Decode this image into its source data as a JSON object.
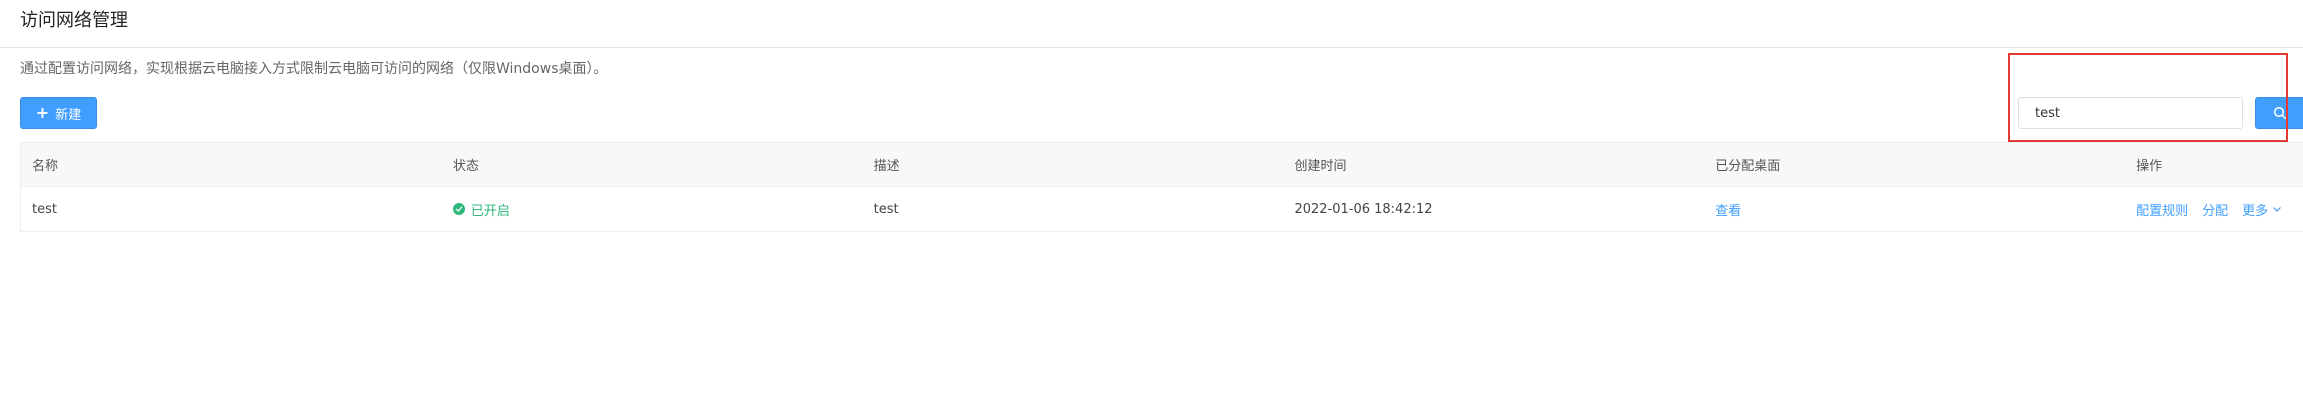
{
  "page": {
    "title": "访问网络管理",
    "description": "通过配置访问网络，实现根据云电脑接入方式限制云电脑可访问的网络（仅限Windows桌面）。"
  },
  "toolbar": {
    "new_label": "新建"
  },
  "search": {
    "value": "test",
    "icon": "search-icon"
  },
  "table": {
    "headers": [
      "名称",
      "状态",
      "描述",
      "创建时间",
      "已分配桌面",
      "操作"
    ],
    "rows": [
      {
        "name": "test",
        "status": "已开启",
        "description": "test",
        "created_at": "2022-01-06 18:42:12",
        "assigned_desktops": "查看",
        "actions": {
          "configure_rules": "配置规则",
          "assign": "分配",
          "more": "更多"
        }
      }
    ]
  },
  "colors": {
    "primary": "#409eff",
    "status_enabled": "#2fb87a",
    "highlight": "#e53935"
  }
}
